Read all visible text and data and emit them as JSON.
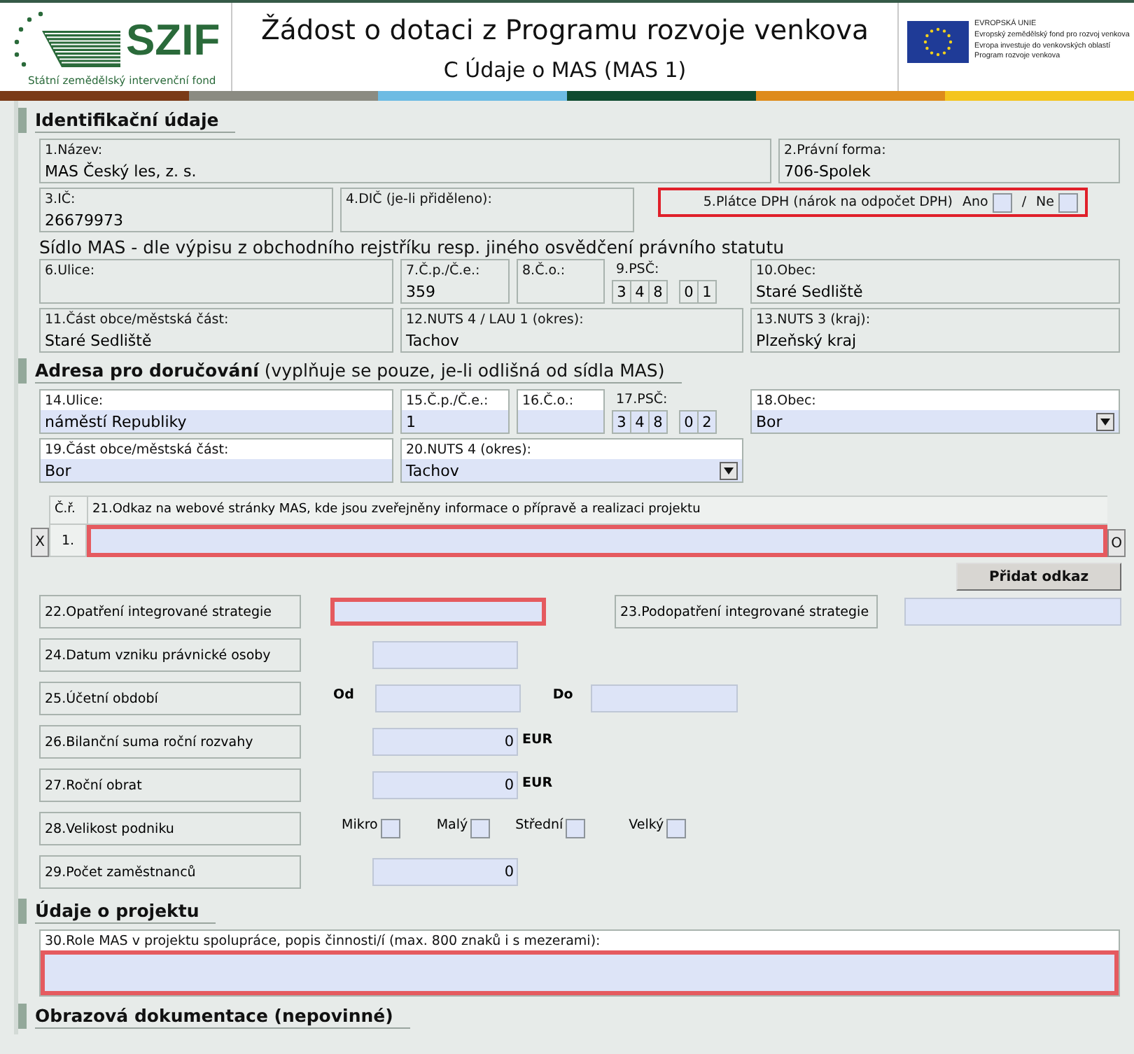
{
  "header": {
    "logo_text": "SZIF",
    "logo_subtitle": "Státní zemědělský intervenční fond",
    "title": "Žádost o dotaci z Programu rozvoje venkova",
    "subtitle": "C Údaje o MAS (MAS 1)",
    "eu_lines": [
      "EVROPSKÁ UNIE",
      "Evropský zemědělský fond pro rozvoj venkova",
      "Evropa investuje do venkovských oblastí",
      "Program rozvoje venkova"
    ]
  },
  "identification": {
    "title": "Identifikační údaje",
    "rows": [
      {
        "fields": [
          {
            "kind": "text",
            "label": "1.Název:",
            "value": "MAS Český les, z. s.",
            "editable": false
          },
          {
            "kind": "text",
            "label": "2.Právní forma:",
            "value": "706-Spolek",
            "editable": false
          }
        ]
      },
      {
        "fields": [
          {
            "kind": "text",
            "label": "3.IČ:",
            "value": "26679973",
            "editable": false
          },
          {
            "kind": "text",
            "label": "4.DIČ (je-li přiděleno):",
            "editable": false
          },
          {
            "kind": "vat",
            "label": "5.Plátce DPH (nárok na odpočet DPH)",
            "separator": "/",
            "invalid": true,
            "options": [
              {
                "label": "Ano",
                "checked": false
              },
              {
                "label": "Ne",
                "checked": false
              }
            ]
          }
        ]
      }
    ],
    "seat_heading": "Sídlo MAS - dle výpisu z obchodního rejstříku resp. jiného osvědčení právního statutu",
    "seat_rows": [
      {
        "fields": [
          {
            "kind": "text",
            "label": "6.Ulice:",
            "editable": false
          },
          {
            "kind": "text",
            "label": "7.Č.p./Č.e.:",
            "value": "359",
            "editable": false
          },
          {
            "kind": "text",
            "label": "8.Č.o.:",
            "editable": false
          },
          {
            "kind": "psc",
            "label": "9.PSČ:",
            "digits": [
              "3",
              "4",
              "8",
              "0",
              "1"
            ],
            "editable": false
          },
          {
            "kind": "text",
            "label": "10.Obec:",
            "value": "Staré Sedliště",
            "editable": false
          }
        ]
      },
      {
        "fields": [
          {
            "kind": "text",
            "label": "11.Část obce/městská část:",
            "value": "Staré Sedliště",
            "editable": false
          },
          {
            "kind": "text",
            "label": "12.NUTS 4 / LAU 1 (okres):",
            "value": "Tachov",
            "editable": false
          },
          {
            "kind": "text",
            "label": "13.NUTS 3 (kraj):",
            "value": "Plzeňský kraj",
            "editable": false
          }
        ]
      }
    ]
  },
  "delivery": {
    "title": "**Adresa pro doručování** (vyplňuje se pouze, je-li odlišná od sídla MAS)",
    "rows": [
      {
        "fields": [
          {
            "kind": "text",
            "label": "14.Ulice:",
            "value": "náměstí Republiky",
            "editable": true
          },
          {
            "kind": "text",
            "label": "15.Č.p./Č.e.:",
            "value": "1",
            "editable": true
          },
          {
            "kind": "text",
            "label": "16.Č.o.:",
            "editable": true
          },
          {
            "kind": "psc",
            "label": "17.PSČ:",
            "digits": [
              "3",
              "4",
              "8",
              "0",
              "2"
            ],
            "editable": true
          },
          {
            "kind": "select",
            "label": "18.Obec:",
            "value": "Bor",
            "editable": true
          }
        ]
      },
      {
        "fields": [
          {
            "kind": "text",
            "label": "19.Část obce/městská část:",
            "value": "Bor",
            "editable": true
          },
          {
            "kind": "select",
            "label": "20.NUTS 4 (okres):",
            "value": "Tachov",
            "editable": true
          }
        ]
      }
    ],
    "link_table": {
      "remove_label": "X",
      "open_label": "O",
      "add_label": "Přidat odkaz",
      "columns": [
        "Č.ř.",
        "21.Odkaz na webové stránky MAS, kde jsou zveřejněny informace o přípravě a realizaci projektu"
      ],
      "rows": [
        {
          "number": "1.",
          "invalid": true
        }
      ]
    },
    "details": [
      {
        "kind": "pair",
        "label": "22.Opatření integrované strategie",
        "invalid": true,
        "second_label": "23.Podopatření integrované strategie"
      },
      {
        "kind": "date",
        "label": "24.Datum vzniku právnické osoby"
      },
      {
        "kind": "range",
        "label": "25.Účetní období",
        "from_label": "Od",
        "to_label": "Do"
      },
      {
        "kind": "amount",
        "label": "26.Bilanční suma roční rozvahy",
        "value": "0",
        "unit": "EUR"
      },
      {
        "kind": "amount",
        "label": "27.Roční obrat",
        "value": "0",
        "unit": "EUR"
      },
      {
        "kind": "checks",
        "label": "28.Velikost podniku",
        "options": [
          {
            "label": "Mikro",
            "checked": false
          },
          {
            "label": "Malý",
            "checked": false
          },
          {
            "label": "Střední",
            "checked": false
          },
          {
            "label": "Velký",
            "checked": false
          }
        ]
      },
      {
        "kind": "number",
        "label": "29.Počet zaměstnanců",
        "value": "0"
      }
    ]
  },
  "project": {
    "title": "Údaje o projektu",
    "label": "30.Role MAS v projektu spolupráce, popis činnosti/í (max. 800 znaků i s mezerami):",
    "invalid": true
  },
  "images": {
    "title": "Obrazová dokumentace (nepovinné)"
  }
}
